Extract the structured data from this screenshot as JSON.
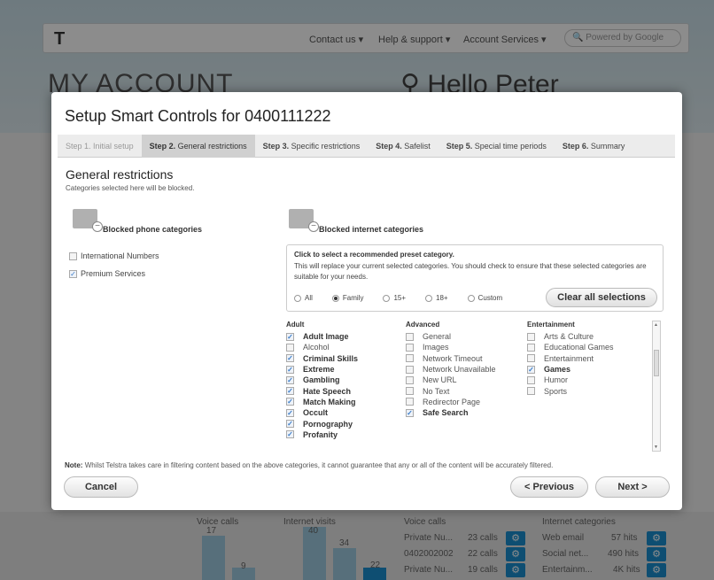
{
  "background": {
    "nav": {
      "logo": "T",
      "items": [
        "Contact us ▾",
        "Help & support ▾",
        "Account Services ▾"
      ],
      "search_placeholder": "Powered by Google"
    },
    "page_title": "MY ACCOUNT",
    "greeting": "Hello Peter",
    "bottom": {
      "voice_calls_label": "Voice calls",
      "internet_visits_label": "Internet visits",
      "bar_values": [
        "17",
        "9",
        "40",
        "34",
        "22"
      ],
      "voice_calls_header": "Voice calls",
      "internet_categories_header": "Internet categories",
      "voice_rows": [
        {
          "name": "Private Nu...",
          "value": "23 calls"
        },
        {
          "name": "0402002002",
          "value": "22 calls"
        },
        {
          "name": "Private Nu...",
          "value": "19 calls"
        }
      ],
      "internet_rows": [
        {
          "name": "Web email",
          "value": "57 hits"
        },
        {
          "name": "Social net...",
          "value": "490 hits"
        },
        {
          "name": "Entertainm...",
          "value": "4K hits"
        }
      ]
    }
  },
  "modal": {
    "title": "Setup Smart Controls for 0400111222",
    "steps": [
      {
        "num": "Step 1.",
        "label": "Initial setup"
      },
      {
        "num": "Step 2.",
        "label": "General restrictions"
      },
      {
        "num": "Step 3.",
        "label": "Specific restrictions"
      },
      {
        "num": "Step 4.",
        "label": "Safelist"
      },
      {
        "num": "Step 5.",
        "label": "Special time periods"
      },
      {
        "num": "Step 6.",
        "label": "Summary"
      }
    ],
    "section_title": "General restrictions",
    "section_subtitle": "Categories selected here will be blocked.",
    "phone_heading": "Blocked phone categories",
    "phone_items": [
      {
        "label": "International Numbers",
        "checked": false
      },
      {
        "label": "Premium Services",
        "checked": true
      }
    ],
    "internet_heading": "Blocked internet categories",
    "preset": {
      "heading": "Click to select a recommended preset category.",
      "description": "This will replace your current selected categories. You should check to ensure that these selected categories are suitable for your needs.",
      "options": [
        "All",
        "Family",
        "15+",
        "18+",
        "Custom"
      ],
      "selected": "Family",
      "clear_label": "Clear all selections"
    },
    "columns": [
      {
        "title": "Adult",
        "items": [
          {
            "label": "Adult Image",
            "checked": true
          },
          {
            "label": "Alcohol",
            "checked": false
          },
          {
            "label": "Criminal Skills",
            "checked": true
          },
          {
            "label": "Extreme",
            "checked": true
          },
          {
            "label": "Gambling",
            "checked": true
          },
          {
            "label": "Hate Speech",
            "checked": true
          },
          {
            "label": "Match Making",
            "checked": true
          },
          {
            "label": "Occult",
            "checked": true
          },
          {
            "label": "Pornography",
            "checked": true
          },
          {
            "label": "Profanity",
            "checked": true
          }
        ]
      },
      {
        "title": "Advanced",
        "items": [
          {
            "label": "General",
            "checked": false
          },
          {
            "label": "Images",
            "checked": false
          },
          {
            "label": "Network Timeout",
            "checked": false
          },
          {
            "label": "Network Unavailable",
            "checked": false
          },
          {
            "label": "New URL",
            "checked": false
          },
          {
            "label": "No Text",
            "checked": false
          },
          {
            "label": "Redirector Page",
            "checked": false
          },
          {
            "label": "Safe Search",
            "checked": true
          }
        ]
      },
      {
        "title": "Entertainment",
        "items": [
          {
            "label": "Arts & Culture",
            "checked": false
          },
          {
            "label": "Educational Games",
            "checked": false
          },
          {
            "label": "Entertainment",
            "checked": false
          },
          {
            "label": "Games",
            "checked": true
          },
          {
            "label": "Humor",
            "checked": false
          },
          {
            "label": "Sports",
            "checked": false
          }
        ]
      }
    ],
    "note_prefix": "Note:",
    "note_text": "Whilst Telstra takes care in filtering content based on the above categories, it cannot guarantee that any or all of the content will be accurately filtered.",
    "buttons": {
      "cancel": "Cancel",
      "previous": "< Previous",
      "next": "Next >"
    }
  }
}
